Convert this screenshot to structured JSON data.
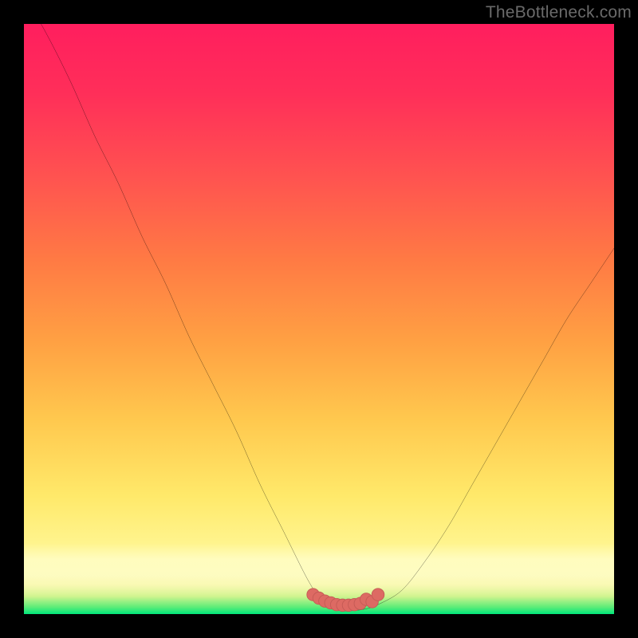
{
  "watermark": "TheBottleneck.com",
  "colors": {
    "background": "#000000",
    "curve_stroke": "#000000",
    "marker_fill": "#dd6a63",
    "marker_stroke": "#c45a55",
    "watermark": "#6a6a6a"
  },
  "chart_data": {
    "type": "line",
    "title": "",
    "xlabel": "",
    "ylabel": "",
    "xlim": [
      0,
      100
    ],
    "ylim": [
      0,
      100
    ],
    "grid": false,
    "annotations": [],
    "series": [
      {
        "name": "bottleneck-curve",
        "x": [
          0,
          4,
          8,
          12,
          16,
          20,
          24,
          28,
          32,
          36,
          40,
          44,
          48,
          50,
          52,
          54,
          56,
          58,
          60,
          64,
          68,
          72,
          76,
          80,
          84,
          88,
          92,
          96,
          100
        ],
        "y": [
          105,
          98,
          90,
          81,
          73,
          64,
          56,
          47,
          39,
          31,
          22,
          14,
          6,
          3,
          1,
          0.6,
          0.6,
          0.9,
          1.6,
          4,
          9,
          15,
          22,
          29,
          36,
          43,
          50,
          56,
          62
        ]
      },
      {
        "name": "optimal-zone-markers",
        "x": [
          49,
          50,
          51,
          52,
          53,
          54,
          55,
          56,
          57,
          58,
          59,
          60
        ],
        "y": [
          3.3,
          2.7,
          2.2,
          1.9,
          1.6,
          1.5,
          1.5,
          1.6,
          1.8,
          2.5,
          2.1,
          3.3
        ]
      }
    ]
  }
}
